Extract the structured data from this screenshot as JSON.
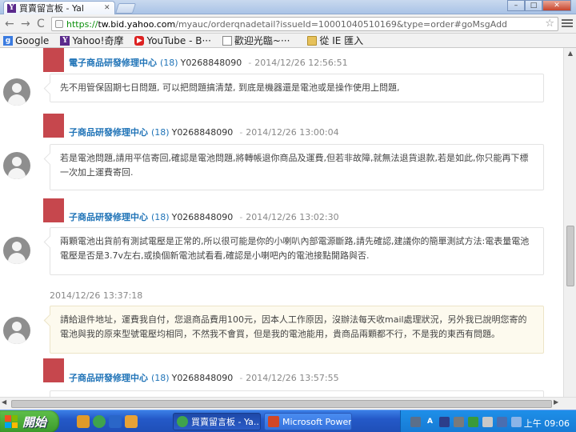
{
  "browser": {
    "tab_title": "買賣留言板 - Yal",
    "tab_close": "✕",
    "url_scheme": "https://",
    "url_host": "tw.bid.yahoo.com",
    "url_path": "/myauc/orderqnadetail?issueId=10001040510169&type=order#goMsgAdd",
    "back": "←",
    "forward": "→",
    "reload": "C",
    "star": "☆",
    "win_min": "–",
    "win_max": "□",
    "win_close": "✕"
  },
  "bookmarks": [
    {
      "icon": "google-icon",
      "label": "Google",
      "glyph": "g"
    },
    {
      "icon": "yahoo-icon",
      "label": "Yahoo!奇摩",
      "glyph": "Y"
    },
    {
      "icon": "youtube-icon",
      "label": "YouTube - B···",
      "glyph": "▶"
    },
    {
      "icon": "document-icon",
      "label": "歡迎光臨~···",
      "glyph": ""
    },
    {
      "icon": "folder-icon",
      "label": "從 IE 匯入",
      "glyph": ""
    }
  ],
  "messages": [
    {
      "seller": "電子商品研發修理中心",
      "count": "(18)",
      "uid": "Y0268848090",
      "sep": "-",
      "time": "2014/12/26 12:56:51",
      "text": "先不用管保固期七日問題, 可以把問題搞清楚, 到底是機器還是電池或是操作使用上問題,"
    },
    {
      "seller": "子商品研發修理中心",
      "count": "(18)",
      "uid": "Y0268848090",
      "sep": "-",
      "time": "2014/12/26 13:00:04",
      "text": "若是電池問題,請用平信寄回,確認是電池問題,將轉帳退你商品及運費,但若非故障,就無法退貨退款,若是如此,你只能再下標一次加上運費寄回."
    },
    {
      "seller": "子商品研發修理中心",
      "count": "(18)",
      "uid": "Y0268848090",
      "sep": "-",
      "time": "2014/12/26 13:02:30",
      "text": "兩顆電池出貨前有測試電壓是正常的,所以很可能是你的小喇叭內部電源斷路,請先確認,建議你的簡單測試方法:電表量電池電壓是否是3.7v左右,或換個新電池試看看,確認是小喇吧內的電池接點開路與否."
    }
  ],
  "buyer_message": {
    "date": "2014/12/26 13:37:18",
    "text": "請給退件地址，運費我自付，您退商品費用100元，因本人工作原因，沒辦法每天收mail處理狀況，另外我已說明您寄的電池與我的原來型號電壓均相同，不然我不會買，但是我的電池能用，貴商品兩顆都不行，不是我的東西有問題。"
  },
  "last_message": {
    "seller": "子商品研發修理中心",
    "count": "(18)",
    "uid": "Y0268848090",
    "sep": "-",
    "time": "2014/12/26 13:57:55"
  },
  "taskbar": {
    "start_label": "開始",
    "buttons": [
      {
        "label": "買賣留言板 - Ya...",
        "state": "active"
      },
      {
        "label": "Microsoft PowerP...",
        "state": "inactive"
      }
    ],
    "clock": "上午 09:06",
    "tray_a": "A"
  },
  "colors": {
    "seller_blue": "#1f73b7",
    "red_block": "#c6474d",
    "buyer_bubble": "#fdfaee",
    "taskbar_blue": "#2459c8"
  }
}
